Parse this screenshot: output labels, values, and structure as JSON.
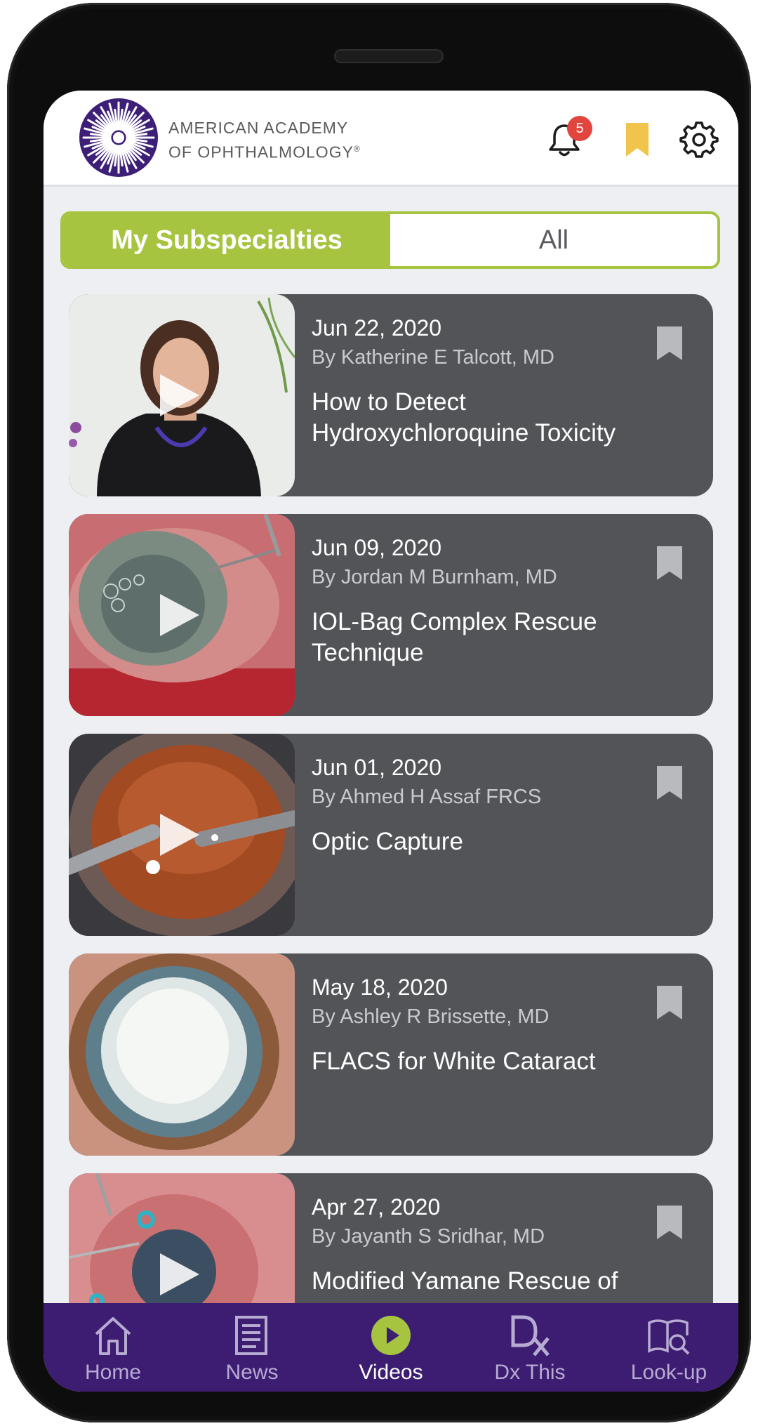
{
  "header": {
    "logo_line1": "AMERICAN ACADEMY",
    "logo_line2": "OF OPHTHALMOLOGY",
    "logo_mark": "®",
    "notifications_count": "5"
  },
  "tabs": {
    "active": "My Subspecialties",
    "inactive": "All"
  },
  "videos": [
    {
      "date": "Jun 22, 2020",
      "author": "By Katherine E Talcott, MD",
      "title": "How to Detect Hydroxychloroquine Toxicity",
      "thumb": "presenter"
    },
    {
      "date": "Jun 09, 2020",
      "author": "By Jordan M Burnham, MD",
      "title": "IOL-Bag Complex Rescue Technique",
      "thumb": "surgery-red"
    },
    {
      "date": "Jun 01, 2020",
      "author": "By Ahmed H Assaf FRCS",
      "title": "Optic Capture",
      "thumb": "surgery-orange"
    },
    {
      "date": "May 18, 2020",
      "author": "By Ashley R Brissette, MD",
      "title": "FLACS for White Cataract",
      "thumb": "cataract"
    },
    {
      "date": "Apr 27, 2020",
      "author": "By Jayanth S Sridhar, MD",
      "title": "Modified Yamane Rescue of",
      "thumb": "surgery-pink"
    }
  ],
  "nav": [
    {
      "label": "Home",
      "icon": "home-icon"
    },
    {
      "label": "News",
      "icon": "news-icon"
    },
    {
      "label": "Videos",
      "icon": "videos-icon",
      "active": true
    },
    {
      "label": "Dx This",
      "icon": "dx-icon"
    },
    {
      "label": "Look-up",
      "icon": "lookup-icon"
    }
  ],
  "colors": {
    "accent_green": "#a6c440",
    "nav_purple": "#3c1d72",
    "card_gray": "#525458",
    "bookmark_yellow": "#f1c54b",
    "badge_red": "#e0463e"
  }
}
